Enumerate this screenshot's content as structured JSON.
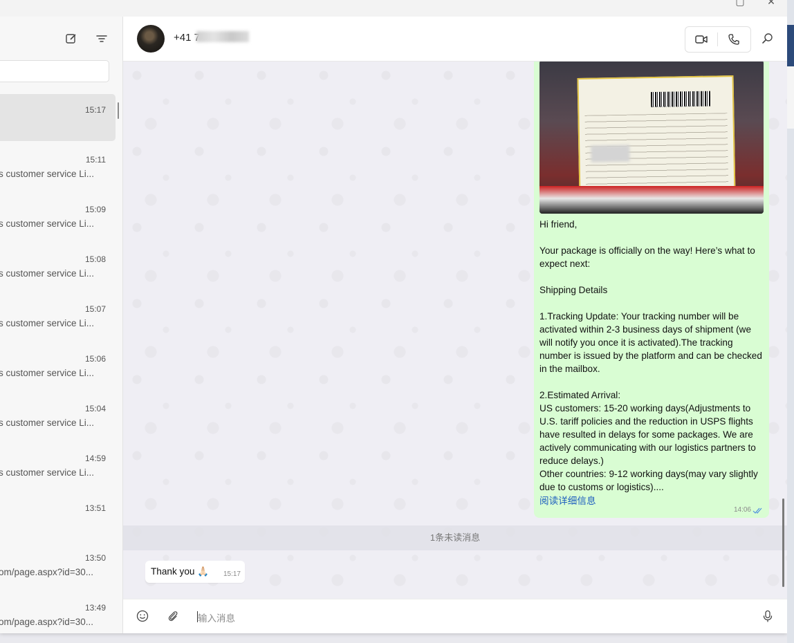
{
  "header": {
    "contact_name": "+41 7"
  },
  "sidebar": {
    "chats": [
      {
        "time": "15:17",
        "preview": ""
      },
      {
        "time": "15:11",
        "preview": "s customer service Li..."
      },
      {
        "time": "15:09",
        "preview": "s customer service Li..."
      },
      {
        "time": "15:08",
        "preview": "s customer service Li..."
      },
      {
        "time": "15:07",
        "preview": "s customer service Li..."
      },
      {
        "time": "15:06",
        "preview": "s customer service Li..."
      },
      {
        "time": "15:04",
        "preview": "s customer service Li..."
      },
      {
        "time": "14:59",
        "preview": "s customer service Li..."
      },
      {
        "time": "13:51",
        "preview": ""
      },
      {
        "time": "13:50",
        "preview": "om/page.aspx?id=30..."
      },
      {
        "time": "13:49",
        "preview": "om/page.aspx?id=30..."
      }
    ]
  },
  "messages": {
    "incoming": {
      "text": "Hi friend,\n\nYour package is officially on the way!  Here’s what to expect next:\n\nShipping Details\n\n1.Tracking Update: Your tracking number will be activated within 2-3 business days of shipment (we will notify you once it is activated).The tracking number is issued by the platform and can be checked in the mailbox.\n\n2.Estimated Arrival:\nUS customers: 15-20 working days(Adjustments to U.S. tariff policies and the reduction in USPS flights have resulted in delays for some packages. We are actively communicating with our logistics partners to reduce delays.)\nOther countries: 9-12 working days(may vary slightly due to customs or logistics)....",
      "read_more": "阅读详细信息",
      "time": "14:06"
    },
    "unread_divider": "1条未读消息",
    "outgoing": {
      "text": "Thank you 🙏🏻",
      "time": "15:17"
    }
  },
  "input": {
    "placeholder": "输入消息"
  },
  "colors": {
    "incoming_bubble": "#d9fdd3",
    "link": "#1f5fbf",
    "read_ticks": "#4f8fdf"
  }
}
